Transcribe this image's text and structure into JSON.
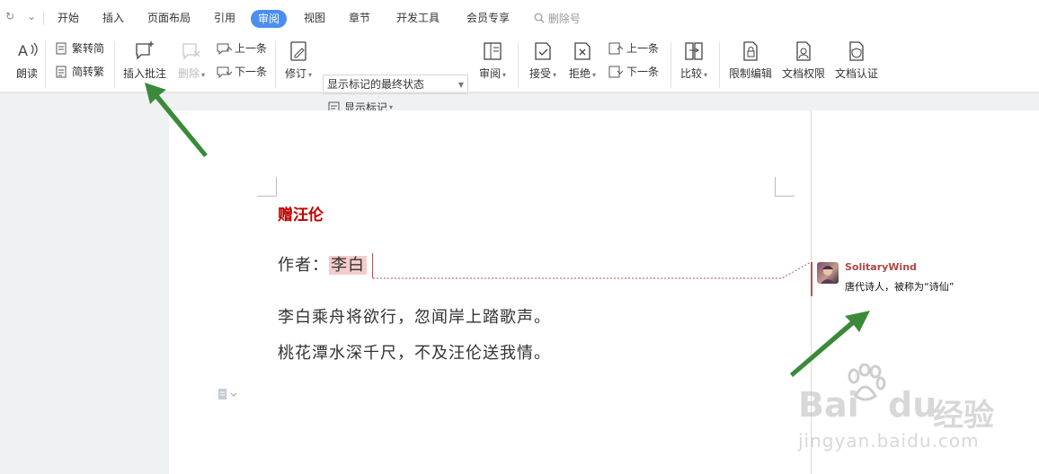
{
  "menubar": {
    "quick_access": [
      "↻",
      "⌄"
    ],
    "tabs": [
      "开始",
      "插入",
      "页面布局",
      "引用",
      "审阅",
      "视图",
      "章节",
      "开发工具",
      "会员专享"
    ],
    "active_tab": "审阅",
    "search_placeholder": "删除号"
  },
  "toolbar": {
    "read_aloud": "朗读",
    "trad_to_simp": "繁转简",
    "simp_to_trad": "简转繁",
    "insert_comment": "插入批注",
    "delete_comment": "删除",
    "prev_comment": "上一条",
    "next_comment": "下一条",
    "track_changes": "修订",
    "markup_state": "显示标记的最终状态",
    "show_markup": "显示标记",
    "review_pane": "审阅",
    "accept": "接受",
    "reject": "拒绝",
    "prev_change": "上一条",
    "next_change": "下一条",
    "compare": "比较",
    "restrict_editing": "限制编辑",
    "doc_permissions": "文档权限",
    "doc_certification": "文档认证"
  },
  "document": {
    "title": "赠汪伦",
    "author_label": "作者：",
    "author_name": "李白",
    "line1": "李白乘舟将欲行，忽闻岸上踏歌声。",
    "line2": "桃花潭水深千尺，不及汪伦送我情。"
  },
  "comment": {
    "author": "SolitaryWind",
    "text": "唐代诗人，被称为“诗仙”"
  },
  "watermark": {
    "brand": "Bai",
    "brand2": "du",
    "cn": "经验",
    "url": "jingyan.baidu.com"
  },
  "colors": {
    "accent": "#4a8ef2",
    "title_red": "#c00000",
    "comment_author": "#b14545",
    "arrow_green": "#3a8a3a"
  }
}
